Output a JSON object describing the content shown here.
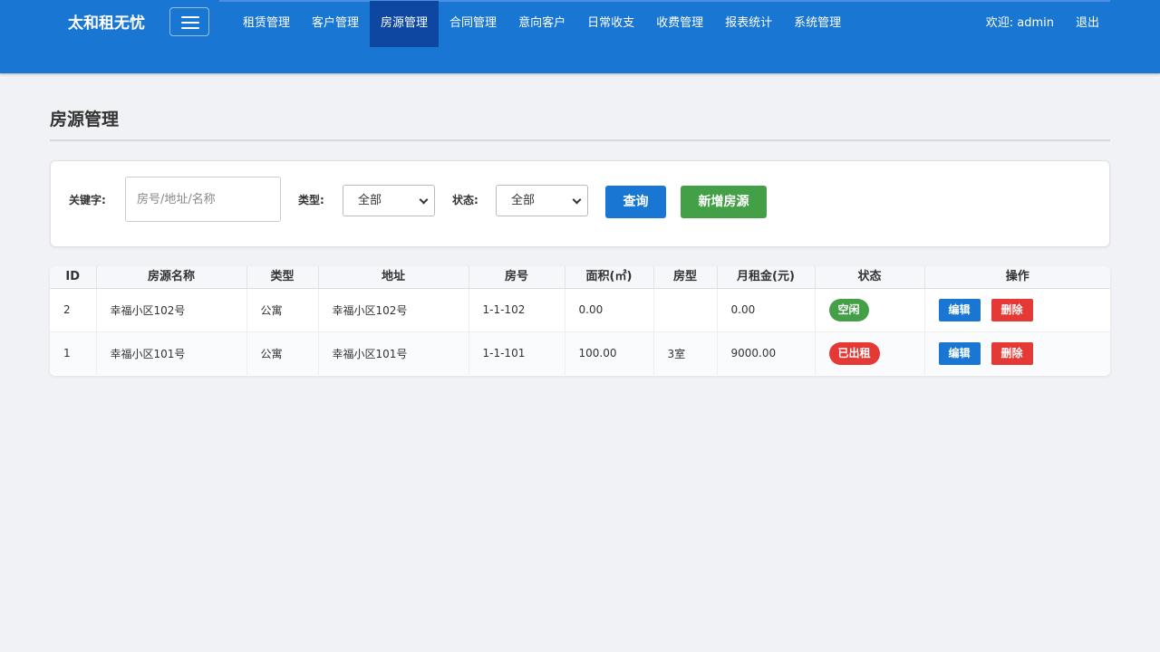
{
  "app": {
    "brand": "太和租无忧"
  },
  "nav": {
    "items": [
      {
        "label": "租赁管理",
        "active": false
      },
      {
        "label": "客户管理",
        "active": false
      },
      {
        "label": "房源管理",
        "active": true
      },
      {
        "label": "合同管理",
        "active": false
      },
      {
        "label": "意向客户",
        "active": false
      },
      {
        "label": "日常收支",
        "active": false
      },
      {
        "label": "收费管理",
        "active": false
      },
      {
        "label": "报表统计",
        "active": false
      },
      {
        "label": "系统管理",
        "active": false
      }
    ],
    "welcome": "欢迎: admin",
    "logout": "退出"
  },
  "page": {
    "title": "房源管理"
  },
  "search": {
    "keyword_label": "关键字:",
    "keyword_placeholder": "房号/地址/名称",
    "keyword_value": "",
    "type_label": "类型:",
    "type_value": "全部",
    "status_label": "状态:",
    "status_value": "全部",
    "query_button": "查询",
    "add_button": "新增房源"
  },
  "table": {
    "columns": [
      "ID",
      "房源名称",
      "类型",
      "地址",
      "房号",
      "面积(㎡)",
      "房型",
      "月租金(元)",
      "状态",
      "操作"
    ],
    "rows": [
      {
        "id": "2",
        "name": "幸福小区102号",
        "type": "公寓",
        "address": "幸福小区102号",
        "room_no": "1-1-102",
        "area": "0.00",
        "layout": "",
        "rent": "0.00",
        "status": "空闲",
        "status_color": "#43a047",
        "edit": "编辑",
        "delete": "删除"
      },
      {
        "id": "1",
        "name": "幸福小区101号",
        "type": "公寓",
        "address": "幸福小区101号",
        "room_no": "1-1-101",
        "area": "100.00",
        "layout": "3室",
        "rent": "9000.00",
        "status": "已出租",
        "status_color": "#e53935",
        "edit": "编辑",
        "delete": "删除"
      }
    ]
  },
  "colors": {
    "primary": "#1976d2",
    "active_nav": "#0d47a1",
    "success": "#43a047",
    "danger": "#e53935"
  }
}
